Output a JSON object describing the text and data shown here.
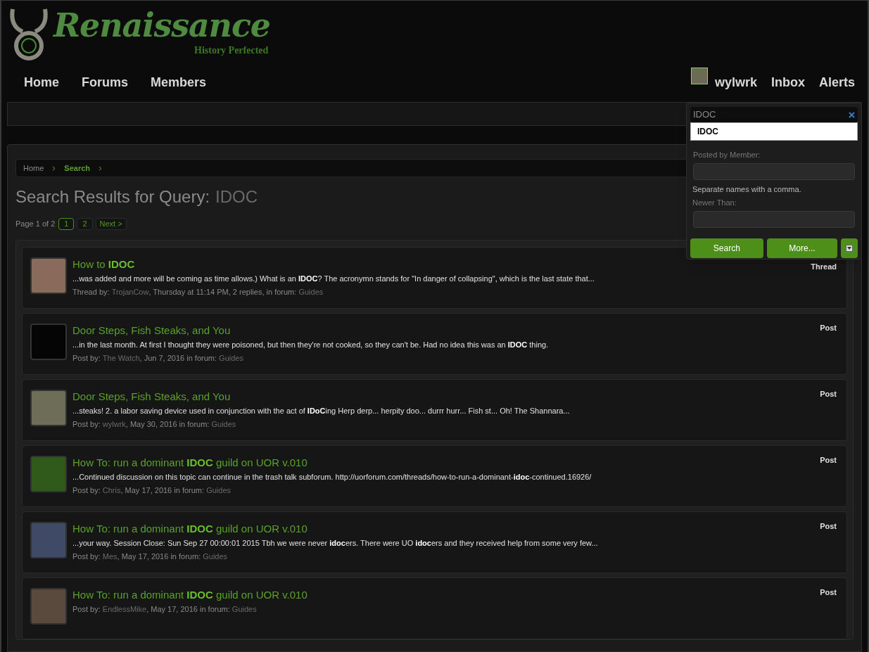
{
  "header": {
    "logo_title": "Renaissance",
    "logo_tagline": "History Perfected",
    "nav": [
      {
        "label": "Home"
      },
      {
        "label": "Forums"
      },
      {
        "label": "Members"
      }
    ],
    "user_name": "wylwrk",
    "user_links": [
      {
        "label": "Inbox"
      },
      {
        "label": "Alerts"
      }
    ]
  },
  "search_popup": {
    "query": "IDOC",
    "suggestion": "IDOC",
    "posted_by_label": "Posted by Member:",
    "hint": "Separate names with a comma.",
    "newer_than_label": "Newer Than:",
    "buttons": [
      {
        "label": "Search"
      },
      {
        "label": "More..."
      }
    ]
  },
  "breadcrumb": [
    {
      "label": "Home",
      "current": false
    },
    {
      "label": "Search",
      "current": true
    }
  ],
  "title": "Search Results for Query:",
  "title_query": "IDOC",
  "pagination": {
    "label": "Page 1 of 2",
    "pages": [
      {
        "label": "1",
        "selected": true
      },
      {
        "label": "2",
        "selected": false
      }
    ],
    "next": "Next >"
  },
  "results": [
    {
      "title": "How to **IDOC**",
      "snippet": "...was added and more will be coming as time allows.) What is an **IDOC**? The acronymn stands for \"In danger of collapsing\", which is the last state that...",
      "by_label": "Thread by:",
      "author": "TrojanCow",
      "meta": ", Thursday at 11:14 PM, 2 replies, in forum:",
      "forum": "Guides",
      "type": "Thread"
    },
    {
      "title": "Door Steps, Fish Steaks, and You",
      "snippet": "...in the last month. At first I thought they were poisoned, but then they're not cooked, so they can't be. Had no idea this was an **IDOC** thing.",
      "by_label": "Post by:",
      "author": "The Watch",
      "meta": ", Jun 7, 2016 in forum:",
      "forum": "Guides",
      "type": "Post"
    },
    {
      "title": "Door Steps, Fish Steaks, and You",
      "snippet": "...steaks! 2. a labor saving device used in conjunction with the act of **IDoC**ing Herp derp... herpity doo... durrr hurr... Fish st... Oh! The Shannara...",
      "by_label": "Post by:",
      "author": "wylwrk",
      "meta": ", May 30, 2016 in forum:",
      "forum": "Guides",
      "type": "Post"
    },
    {
      "title": "How To: run a dominant **IDOC** guild on UOR v.010",
      "snippet": "...Continued discussion on this topic can continue in the trash talk subforum. http://uorforum.com/threads/how-to-run-a-dominant-**idoc**-continued.16926/",
      "by_label": "Post by:",
      "author": "Chris",
      "meta": ", May 17, 2016 in forum:",
      "forum": "Guides",
      "type": "Post"
    },
    {
      "title": "How To: run a dominant **IDOC** guild on UOR v.010",
      "snippet": "...your way. Session Close: Sun Sep 27 00:00:01 2015 Tbh we were never **idoc**ers. There were UO **idoc**ers and they received help from some very few...",
      "by_label": "Post by:",
      "author": "Mes",
      "meta": ", May 17, 2016 in forum:",
      "forum": "Guides",
      "type": "Post"
    },
    {
      "title": "How To: run a dominant **IDOC** guild on UOR v.010",
      "by_label": "Post by:",
      "author": "EndlessMike",
      "meta": ", May 17, 2016 in forum:",
      "forum": "Guides",
      "type": "Post"
    }
  ]
}
